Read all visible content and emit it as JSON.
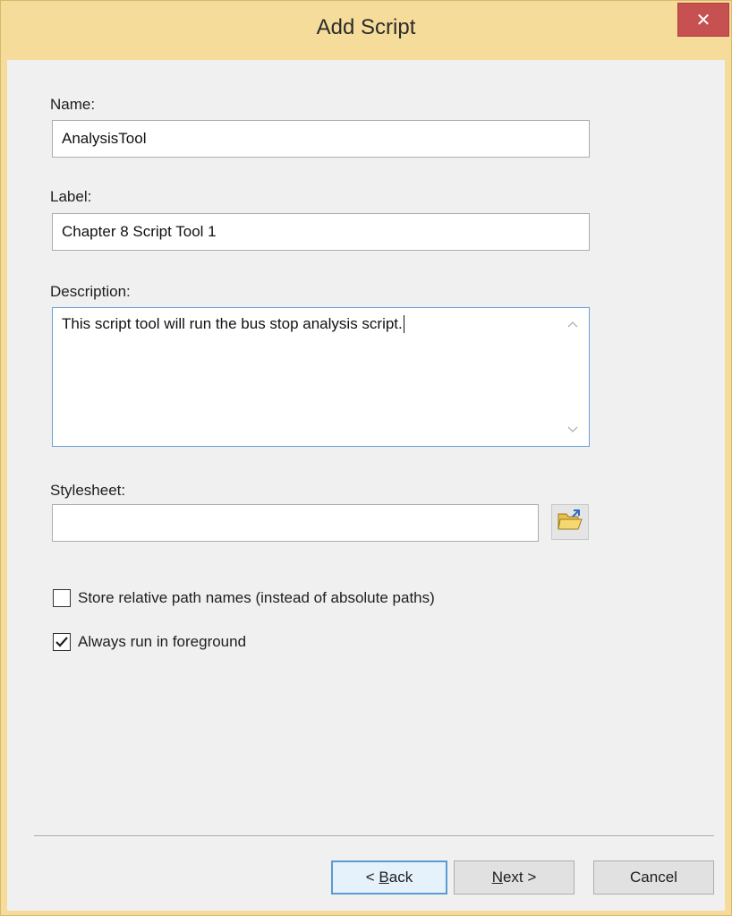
{
  "window": {
    "title": "Add Script",
    "close_glyph": "✕"
  },
  "name": {
    "label": "Name:",
    "value": "AnalysisTool"
  },
  "label_field": {
    "label": "Label:",
    "value": "Chapter 8 Script Tool 1"
  },
  "description": {
    "label": "Description:",
    "value": "This script tool will run the bus stop analysis script."
  },
  "stylesheet": {
    "label": "Stylesheet:",
    "value": "",
    "browse_icon": "open-folder-icon"
  },
  "options": {
    "relative_paths": {
      "label": "Store relative path names (instead of absolute paths)",
      "checked": false
    },
    "foreground": {
      "label": "Always run in foreground",
      "checked": true
    }
  },
  "buttons": {
    "back_prefix": "< ",
    "back_mnemonic": "B",
    "back_rest": "ack",
    "next_mnemonic": "N",
    "next_rest": "ext >",
    "cancel": "Cancel"
  },
  "colors": {
    "frame": "#f5dc9a",
    "close": "#c75050",
    "client": "#f0f0f0",
    "focus_border": "#6a9fd8"
  }
}
